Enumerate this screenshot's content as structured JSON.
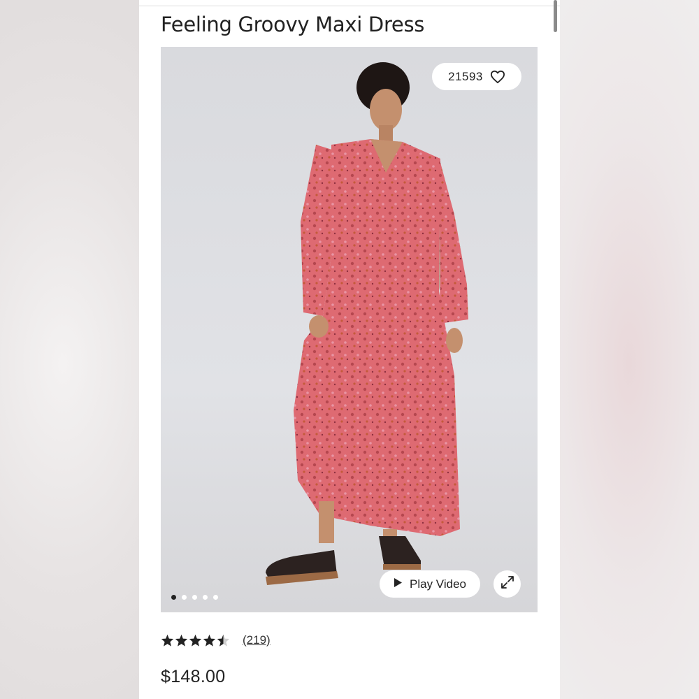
{
  "product": {
    "title": "Feeling Groovy Maxi Dress",
    "favorites_count": "21593",
    "play_video_label": "Play Video",
    "rating": 4.5,
    "review_count": "(219)",
    "price": "$148.00"
  },
  "gallery": {
    "slide_count": 5,
    "active_slide": 1
  },
  "icons": {
    "favorite": "heart-outline-icon",
    "play": "play-triangle-icon",
    "expand": "expand-arrows-icon",
    "rating": "star-icon"
  },
  "colors": {
    "text": "#222222",
    "dress": "#d9606b",
    "background": "#dcdde3"
  }
}
